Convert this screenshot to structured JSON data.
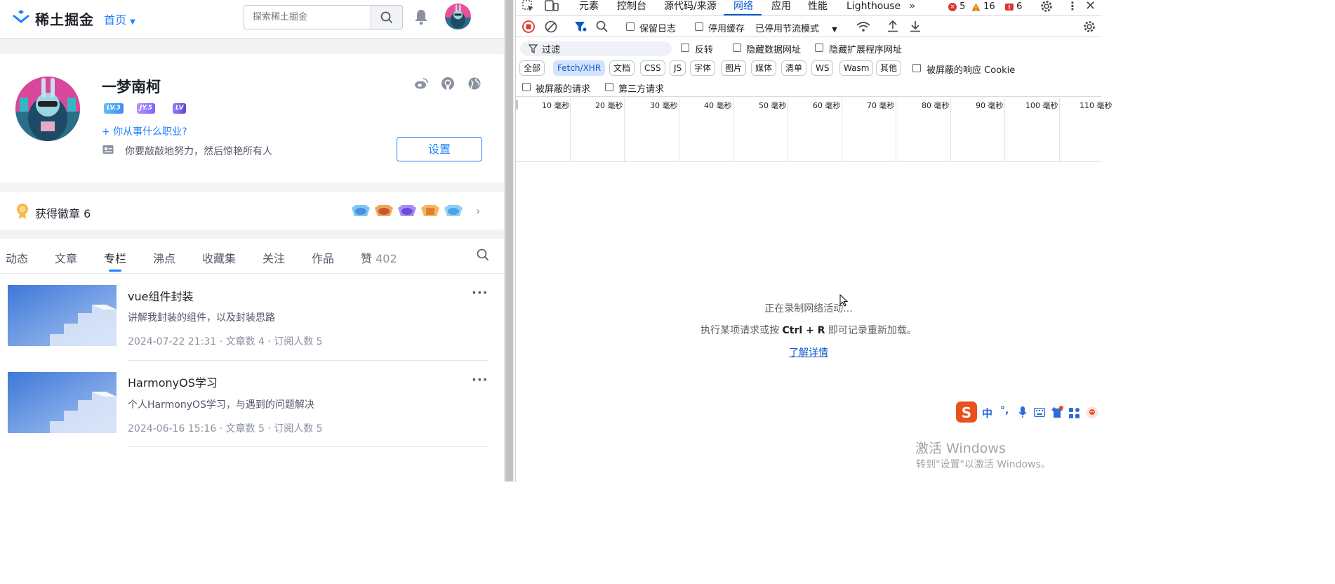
{
  "site": {
    "logo": "稀土掘金",
    "nav_home": "首页",
    "search_placeholder": "探索稀土掘金"
  },
  "profile": {
    "username": "一梦南柯",
    "levels": [
      "LV.3",
      "JY.5",
      "LV"
    ],
    "occupation_prompt": "+ 你从事什么职业?",
    "bio": "你要敲敲地努力，然后惊艳所有人",
    "settings_button": "设置",
    "badges_label": "获得徽章 6"
  },
  "tabs": [
    {
      "label": "动态"
    },
    {
      "label": "文章"
    },
    {
      "label": "专栏",
      "active": true
    },
    {
      "label": "沸点"
    },
    {
      "label": "收藏集"
    },
    {
      "label": "关注"
    },
    {
      "label": "作品"
    },
    {
      "label": "赞",
      "count": "402"
    }
  ],
  "columns": [
    {
      "title": "vue组件封装",
      "desc": "讲解我封装的组件，以及封装思路",
      "meta": "2024-07-22 21:31 · 文章数 4 · 订阅人数 5",
      "more": "···"
    },
    {
      "title": "HarmonyOS学习",
      "desc": "个人HarmonyOS学习，与遇到的问题解决",
      "meta": "2024-06-16 15:16 · 文章数 5 · 订阅人数 5",
      "more": "···"
    }
  ],
  "devtools": {
    "tabs": [
      "元素",
      "控制台",
      "源代码/来源",
      "网络",
      "应用",
      "性能",
      "Lighthouse"
    ],
    "active_tab": "网络",
    "counts": {
      "errors": "5",
      "warnings": "16",
      "issues": "6"
    },
    "toolbar": {
      "preserve_log": "保留日志",
      "disable_cache": "停用缓存",
      "throttling": "已停用节流模式"
    },
    "filter": {
      "placeholder": "过滤",
      "invert": "反转",
      "hide_data_urls": "隐藏数据网址",
      "hide_extension_urls": "隐藏扩展程序网址",
      "types": [
        "全部",
        "Fetch/XHR",
        "文档",
        "CSS",
        "JS",
        "字体",
        "图片",
        "媒体",
        "清单",
        "WS",
        "Wasm",
        "其他"
      ],
      "selected_type": "Fetch/XHR",
      "blocked_cookies": "被屏蔽的响应 Cookie",
      "blocked_requests": "被屏蔽的请求",
      "third_party": "第三方请求"
    },
    "timeline_ticks": [
      "10 毫秒",
      "20 毫秒",
      "30 毫秒",
      "40 毫秒",
      "50 毫秒",
      "60 毫秒",
      "70 毫秒",
      "80 毫秒",
      "90 毫秒",
      "100 毫秒",
      "110 毫秒"
    ],
    "empty_state": {
      "line1": "正在录制网络活动...",
      "line2_prefix": "执行某项请求或按 ",
      "line2_keys": "Ctrl + R",
      "line2_suffix": " 即可记录重新加载。",
      "link": "了解详情"
    }
  },
  "ime": {
    "mode": "中"
  },
  "watermark": {
    "line1": "激活 Windows",
    "line2": "转到\"设置\"以激活 Windows。"
  },
  "colors": {
    "brand": "#1e80ff",
    "devtools_accent": "#0b57d0",
    "error": "#dc362e",
    "warning": "#e37400"
  }
}
